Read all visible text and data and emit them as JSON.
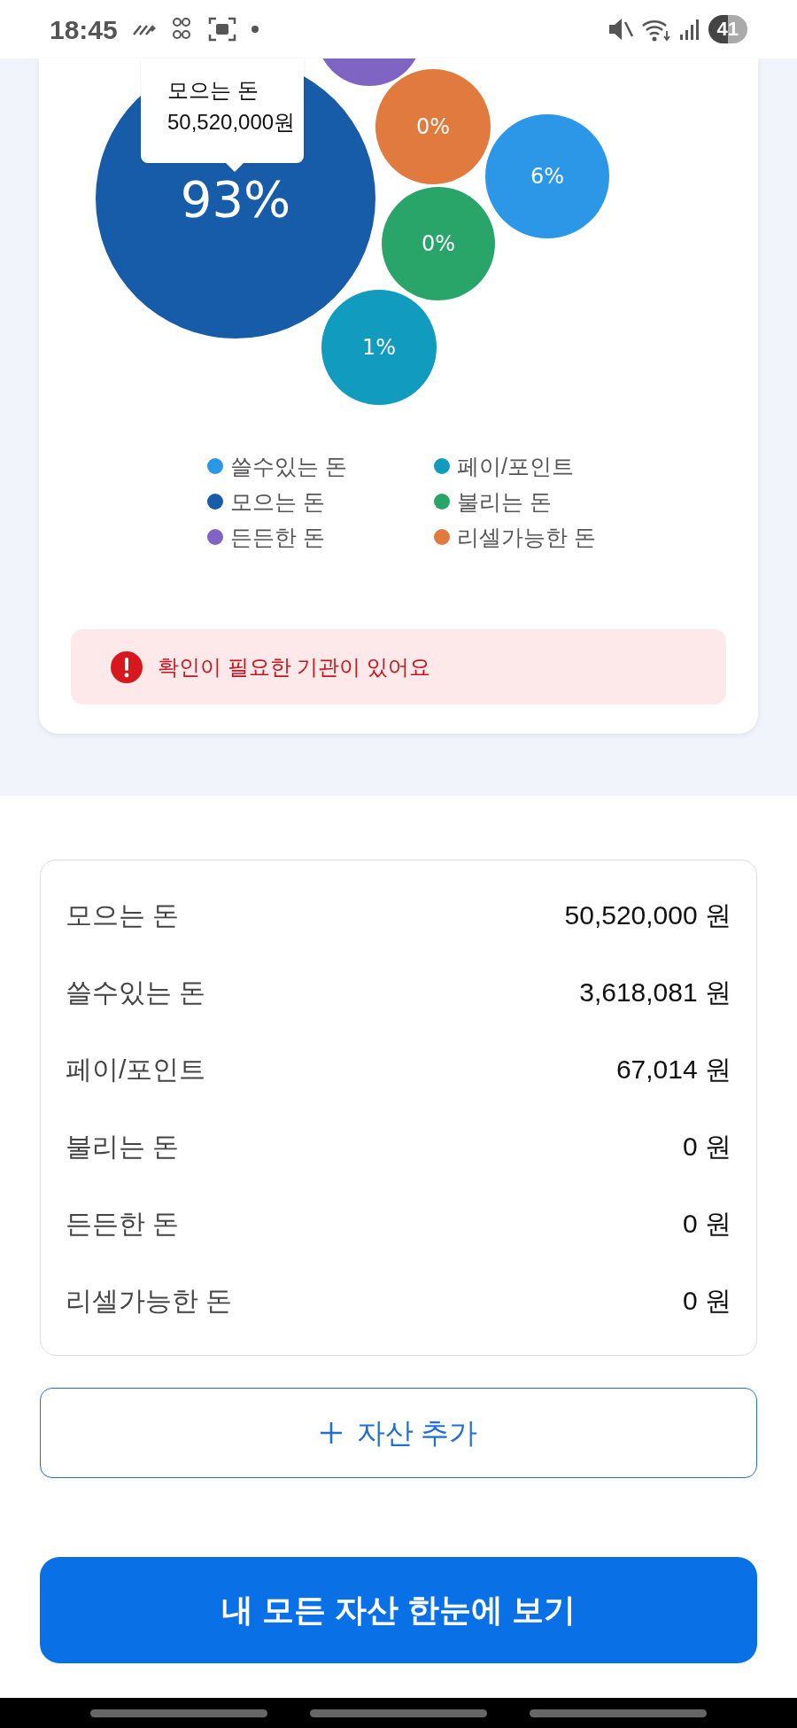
{
  "status_bar": {
    "time": "18:45",
    "battery": "41"
  },
  "chart": {
    "bubbles": [
      {
        "label": "93%",
        "color": "#175ca8"
      },
      {
        "label": "0%",
        "color": "#e07a3e"
      },
      {
        "label": "6%",
        "color": "#2b97e6"
      },
      {
        "label": "0%",
        "color": "#2aa56a"
      },
      {
        "label": "1%",
        "color": "#109bbf"
      },
      {
        "color": "#8064c4"
      }
    ],
    "tooltip": {
      "title": "모으는 돈",
      "value": "50,520,000원"
    }
  },
  "legend": [
    {
      "label": "쓸수있는 돈",
      "color": "#2b97e6"
    },
    {
      "label": "페이/포인트",
      "color": "#109bbf"
    },
    {
      "label": "모으는 돈",
      "color": "#175ca8"
    },
    {
      "label": "불리는 돈",
      "color": "#2aa56a"
    },
    {
      "label": "든든한 돈",
      "color": "#8064c4"
    },
    {
      "label": "리셀가능한 돈",
      "color": "#e07a3e"
    }
  ],
  "alert": {
    "text": "확인이 필요한 기관이 있어요"
  },
  "summary": [
    {
      "label": "모으는 돈",
      "amount": "50,520,000 원"
    },
    {
      "label": "쓸수있는 돈",
      "amount": "3,618,081 원"
    },
    {
      "label": "페이/포인트",
      "amount": "67,014 원"
    },
    {
      "label": "불리는 돈",
      "amount": "0 원"
    },
    {
      "label": "든든한 돈",
      "amount": "0 원"
    },
    {
      "label": "리셀가능한 돈",
      "amount": "0 원"
    }
  ],
  "add_button": {
    "label": "자산 추가"
  },
  "main_button": {
    "label": "내 모든 자산 한눈에 보기"
  }
}
